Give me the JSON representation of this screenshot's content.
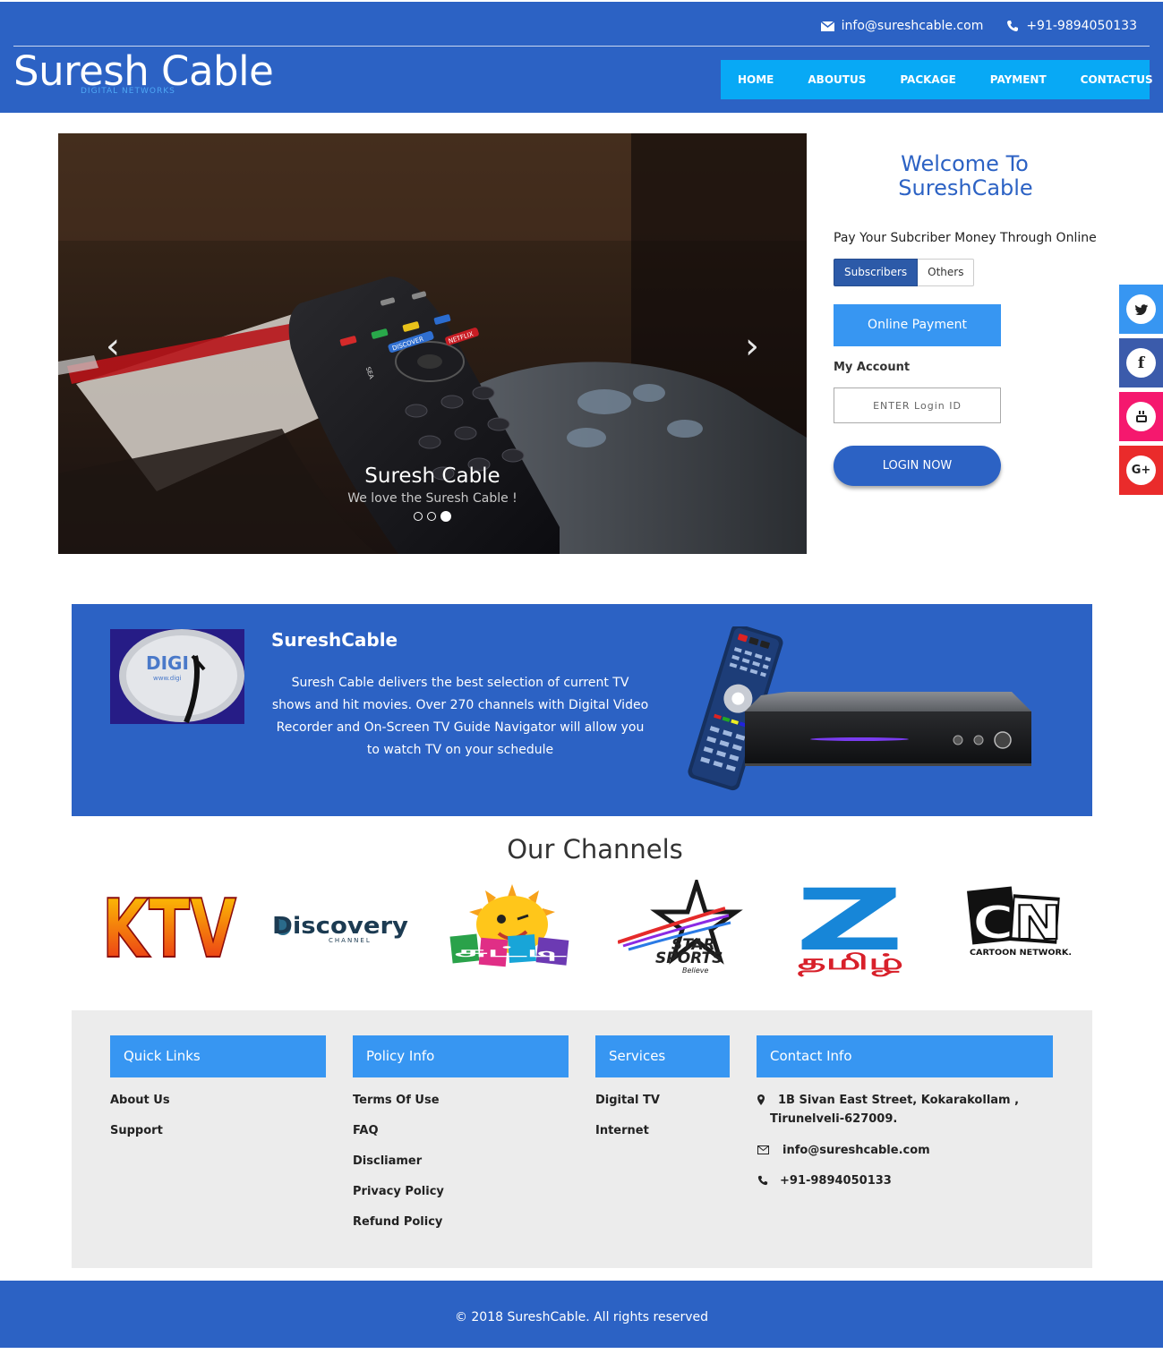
{
  "header": {
    "email": "info@sureshcable.com",
    "phone": "+91-9894050133",
    "brand_name": "Suresh Cable",
    "brand_sub": "DIGITAL NETWORKS",
    "nav": [
      "HOME",
      "ABOUTUS",
      "PACKAGE",
      "PAYMENT",
      "CONTACTUS"
    ]
  },
  "carousel": {
    "caption_title": "Suresh Cable",
    "caption_text": "We love the Suresh Cable !",
    "slides": 3,
    "active_slide": 3,
    "remote_labels": [
      "DISCOVER",
      "NETFLIX",
      "SEA"
    ]
  },
  "welcome": {
    "title_line1": "Welcome To",
    "title_line2": "SureshCable",
    "pay_line": "Pay Your Subcriber Money Through Online",
    "tabs": [
      "Subscribers",
      "Others"
    ],
    "online_payment": "Online Payment",
    "my_account": "My Account",
    "login_placeholder": "ENTER Login ID",
    "login_button": "LOGIN NOW"
  },
  "social": [
    {
      "name": "twitter-icon",
      "color": "#3796f2",
      "glyph": "t"
    },
    {
      "name": "facebook-icon",
      "color": "#3b5bab",
      "glyph": "f"
    },
    {
      "name": "youtube-icon",
      "color": "#f5186e",
      "glyph": "You"
    },
    {
      "name": "google-plus-icon",
      "color": "#ea2b2b",
      "glyph": "G+"
    }
  ],
  "about": {
    "title": "SureshCable",
    "text": "Suresh Cable delivers the best selection of current TV shows and hit movies. Over 270 channels with Digital Video Recorder and On-Screen TV Guide Navigator will allow you to watch TV on your schedule",
    "dish_text": "DIGI",
    "dish_url": "www.digi"
  },
  "channels": {
    "title": "Our Channels",
    "logos": [
      {
        "name": "KTV",
        "text": "KTV"
      },
      {
        "name": "Discovery Channel",
        "text": "Discovery",
        "sub": "CHANNEL"
      },
      {
        "name": "Chutti TV",
        "text": "சுட்டி"
      },
      {
        "name": "Star Sports",
        "text": "STAR",
        "text2": "SPORTS",
        "sub": "Believe"
      },
      {
        "name": "Zee Tamil",
        "text": "Z",
        "sub": "தமிழ்"
      },
      {
        "name": "Cartoon Network",
        "text": "CN",
        "sub": "CARTOON NETWORK."
      }
    ]
  },
  "footer": {
    "quick_links": {
      "title": "Quick Links",
      "items": [
        "About Us",
        "Support"
      ]
    },
    "policy_info": {
      "title": "Policy Info",
      "items": [
        "Terms Of Use",
        "FAQ",
        "Discliamer",
        "Privacy Policy",
        "Refund Policy"
      ]
    },
    "services": {
      "title": "Services",
      "items": [
        "Digital TV",
        "Internet"
      ]
    },
    "contact": {
      "title": "Contact Info",
      "address_line1": "1B Sivan East Street, Kokarakollam ,",
      "address_line2": "Tirunelveli-627009.",
      "email": "info@sureshcable.com",
      "phone": "+91-9894050133"
    },
    "copyright": "© 2018 SureshCable. All rights reserved"
  },
  "colors": {
    "primary": "#2c62c4",
    "accent": "#3796f2",
    "nav": "#08a9f5",
    "footer_bg": "#ececec"
  }
}
